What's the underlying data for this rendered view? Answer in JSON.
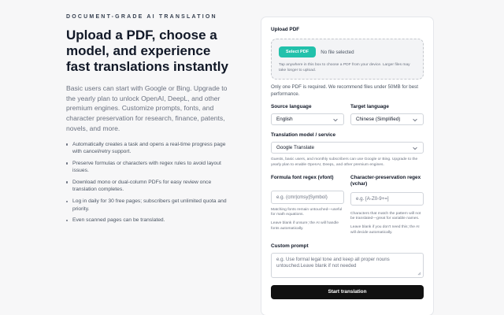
{
  "hero": {
    "eyebrow": "DOCUMENT-GRADE AI TRANSLATION",
    "headline": "Upload a PDF, choose a model, and experience fast translations instantly",
    "lead": "Basic users can start with Google or Bing. Upgrade to the yearly plan to unlock OpenAI, DeepL, and other premium engines. Customize prompts, fonts, and character preservation for research, finance, patents, novels, and more.",
    "bullets": [
      "Automatically creates a task and opens a real-time progress page with cancel/retry support.",
      "Preserve formulas or characters with regex rules to avoid layout issues.",
      "Download mono or dual-column PDFs for easy review once translation completes.",
      "Log in daily for 30 free pages; subscribers get unlimited quota and priority.",
      "Even scanned pages can be translated."
    ]
  },
  "form": {
    "upload_label": "Upload PDF",
    "select_button": "Select PDF",
    "no_file": "No file selected",
    "dropzone_hint": "Tap anywhere in this box to choose a PDF from your device. Larger files may take longer to upload.",
    "pdf_note": "Only one PDF is required. We recommend files under 50MB for best performance.",
    "source_label": "Source language",
    "source_value": "English",
    "target_label": "Target language",
    "target_value": "Chinese (Simplified)",
    "model_label": "Translation model / service",
    "model_value": "Google Translate",
    "model_help": "Guests, basic users, and monthly subscribers can use Google or Bing. Upgrade to the yearly plan to enable OpenAI, DeepL, and other premium engines.",
    "formula_label": "Formula font regex (vfont)",
    "formula_placeholder": "e.g. (cmr|cmsy|Symbol)",
    "formula_help1": "Matching fonts remain untouched—useful for math equations.",
    "formula_help2": "Leave blank if unsure; the AI will handle fonts automatically.",
    "char_label": "Character-preservation regex (vchar)",
    "char_placeholder": "e.g. [A-Z0-9+=]",
    "char_help1": "Characters that match the pattern will not be translated—great for variable names.",
    "char_help2": "Leave blank if you don't need this; the AI will decide automatically.",
    "prompt_label": "Custom prompt",
    "prompt_placeholder": "e.g. Use formal legal tone and keep all proper nouns untouched.Leave blank if not needed",
    "submit": "Start translation"
  },
  "colors": {
    "accent": "#22c1ab",
    "submit_bg": "#111111"
  },
  "icons": {
    "select_chevron": "chevron-down-icon",
    "resize": "resize-grip-icon"
  }
}
